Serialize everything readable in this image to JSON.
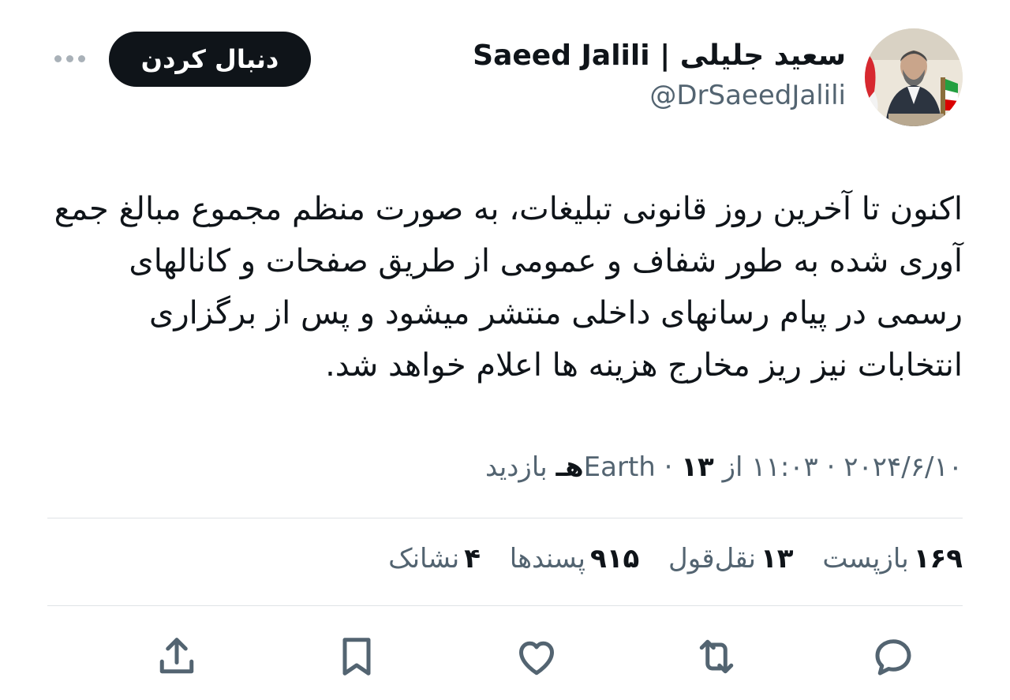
{
  "author": {
    "display_name": "سعید جلیلی | Saeed Jalili",
    "handle": "@DrSaeedJalili",
    "avatar": "profile-photo"
  },
  "follow_label": "دنبال کردن",
  "more_icon": "more-horizontal-icon",
  "tweet": {
    "text": "اکنون تا آخرین روز قانونی تبلیغات، به صورت منظم مجموع مبالغ جمع آوری شده به طور شفاف و عمومی از طریق صفحات و کانالهای رسمی در پیام رسانهای داخلی منتشر میشود و پس از برگزاری انتخابات نیز ریز مخارج هزینه ها اعلام خواهد شد."
  },
  "meta": {
    "date": "۲۰۲۴/۶/۱۰",
    "sep1": " · ",
    "time": "۱۱:۰۳",
    "source": " از Earth",
    "sep2": " · ",
    "views_count": "۱۳هـ",
    "views_label": " بازدید"
  },
  "stats": {
    "reposts": {
      "count": "۱۶۹",
      "label": "بازپست"
    },
    "quotes": {
      "count": "۱۳",
      "label": "نقل‌قول"
    },
    "likes": {
      "count": "۹۱۵",
      "label": "پسندها"
    },
    "bookmarks": {
      "count": "۴",
      "label": "نشانک"
    }
  },
  "actions": [
    "reply-icon",
    "repost-icon",
    "like-icon",
    "bookmark-icon",
    "share-icon"
  ],
  "colors": {
    "text": "#0f1419",
    "secondary": "#536471",
    "divider": "#dfe3e6",
    "button": "#0f1419"
  }
}
